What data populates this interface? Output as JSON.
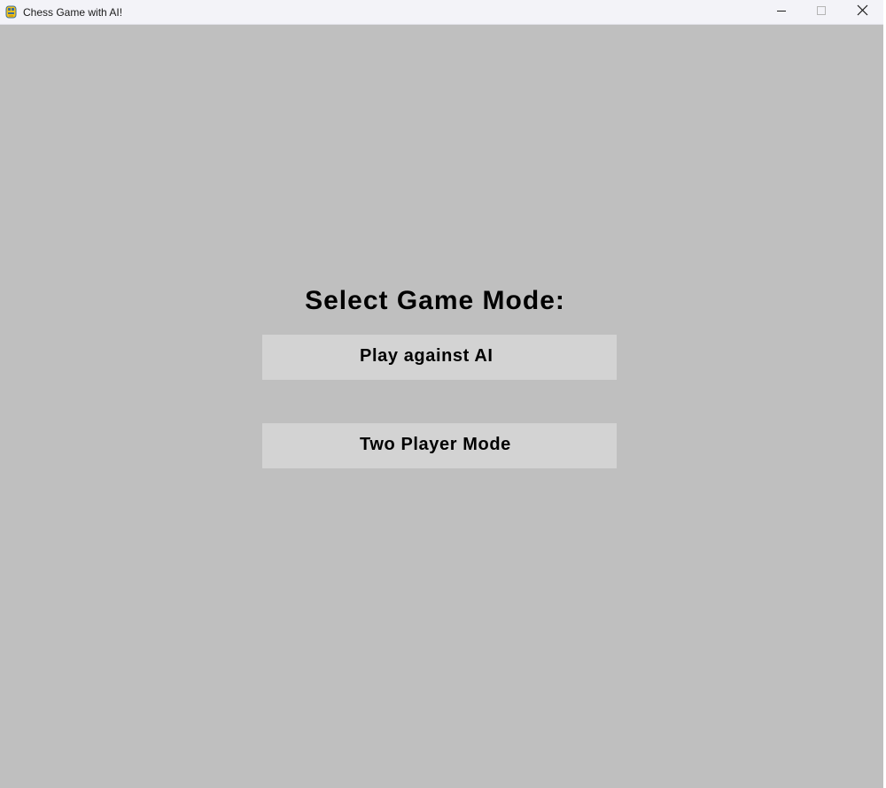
{
  "window": {
    "title": "Chess Game with AI!",
    "controls": {
      "minimize": "minimize-icon",
      "maximize": "maximize-icon",
      "close": "close-icon"
    },
    "background_color": "#bfbfbf"
  },
  "menu": {
    "heading": "Select Game Mode:",
    "buttons": [
      {
        "label": "Play against AI"
      },
      {
        "label": "Two Player Mode"
      }
    ],
    "button_color": "#d3d3d3"
  }
}
